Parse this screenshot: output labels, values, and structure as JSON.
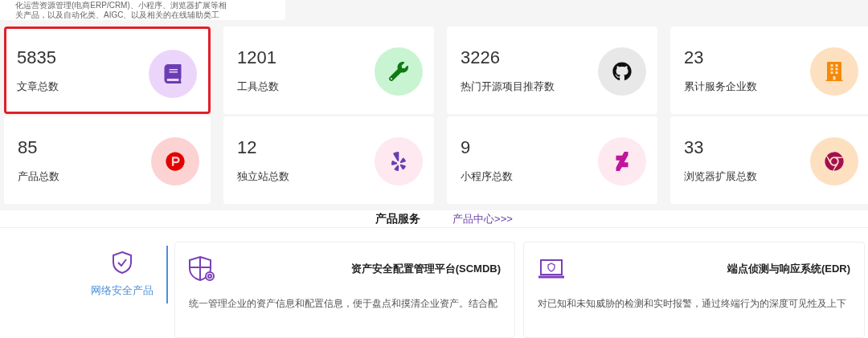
{
  "intro": {
    "lines": [
      "化运营资源管理(电商ERP/CRM)、小程序、浏览器扩展等相",
      "关产品，以及自动化类、AIGC、以及相关的在线辅助类工"
    ]
  },
  "stats": [
    {
      "value": "5835",
      "label": "文章总数",
      "highlighted": true
    },
    {
      "value": "1201",
      "label": "工具总数",
      "highlighted": false
    },
    {
      "value": "3226",
      "label": "热门开源项目推荐数",
      "highlighted": false
    },
    {
      "value": "23",
      "label": "累计服务企业数",
      "highlighted": false
    },
    {
      "value": "85",
      "label": "产品总数",
      "highlighted": false
    },
    {
      "value": "12",
      "label": "独立站总数",
      "highlighted": false
    },
    {
      "value": "9",
      "label": "小程序总数",
      "highlighted": false
    },
    {
      "value": "33",
      "label": "浏览器扩展总数",
      "highlighted": false
    }
  ],
  "product_services": {
    "title": "产品服务",
    "link": "产品中心>>>",
    "categories": [
      {
        "label": "网络安全产品",
        "selected": true
      }
    ],
    "products": [
      {
        "title": "资产安全配置管理平台(SCMDB)",
        "description": "统一管理企业的资产信息和配置信息，便于盘点和摸清企业资产。结合配"
      },
      {
        "title": "端点侦测与响应系统(EDR)",
        "description": "对已知和未知威胁的检测和实时报警，通过终端行为的深度可见性及上下"
      }
    ]
  }
}
